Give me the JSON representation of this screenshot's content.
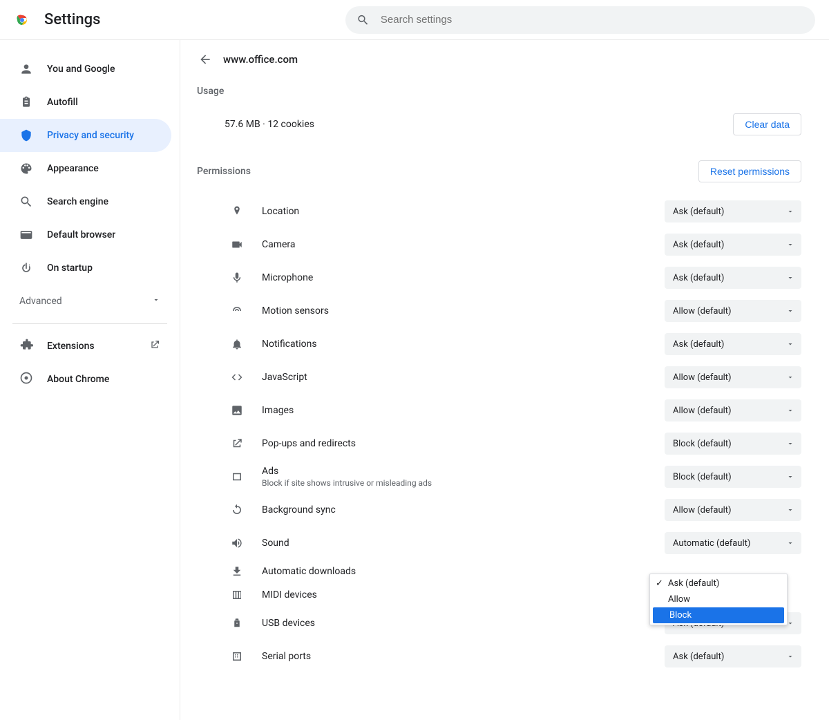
{
  "header": {
    "title": "Settings",
    "search_placeholder": "Search settings"
  },
  "sidebar": {
    "items": [
      {
        "label": "You and Google"
      },
      {
        "label": "Autofill"
      },
      {
        "label": "Privacy and security"
      },
      {
        "label": "Appearance"
      },
      {
        "label": "Search engine"
      },
      {
        "label": "Default browser"
      },
      {
        "label": "On startup"
      }
    ],
    "advanced_label": "Advanced",
    "extensions_label": "Extensions",
    "about_label": "About Chrome"
  },
  "main": {
    "site": "www.office.com",
    "usage_title": "Usage",
    "usage_text": "57.6 MB · 12 cookies",
    "clear_data": "Clear data",
    "permissions_title": "Permissions",
    "reset_permissions": "Reset permissions",
    "permissions": [
      {
        "label": "Location",
        "value": "Ask (default)"
      },
      {
        "label": "Camera",
        "value": "Ask (default)"
      },
      {
        "label": "Microphone",
        "value": "Ask (default)"
      },
      {
        "label": "Motion sensors",
        "value": "Allow (default)"
      },
      {
        "label": "Notifications",
        "value": "Ask (default)"
      },
      {
        "label": "JavaScript",
        "value": "Allow (default)"
      },
      {
        "label": "Images",
        "value": "Allow (default)"
      },
      {
        "label": "Pop-ups and redirects",
        "value": "Block (default)"
      },
      {
        "label": "Ads",
        "sub": "Block if site shows intrusive or misleading ads",
        "value": "Block (default)"
      },
      {
        "label": "Background sync",
        "value": "Allow (default)"
      },
      {
        "label": "Sound",
        "value": "Automatic (default)"
      },
      {
        "label": "Automatic downloads",
        "value": "Ask (default)",
        "open": true
      },
      {
        "label": "MIDI devices",
        "value": ""
      },
      {
        "label": "USB devices",
        "value": "Ask (default)"
      },
      {
        "label": "Serial ports",
        "value": "Ask (default)"
      }
    ],
    "dropdown": {
      "options": [
        "Ask (default)",
        "Allow",
        "Block"
      ],
      "selected": "Ask (default)",
      "highlight": "Block"
    }
  }
}
